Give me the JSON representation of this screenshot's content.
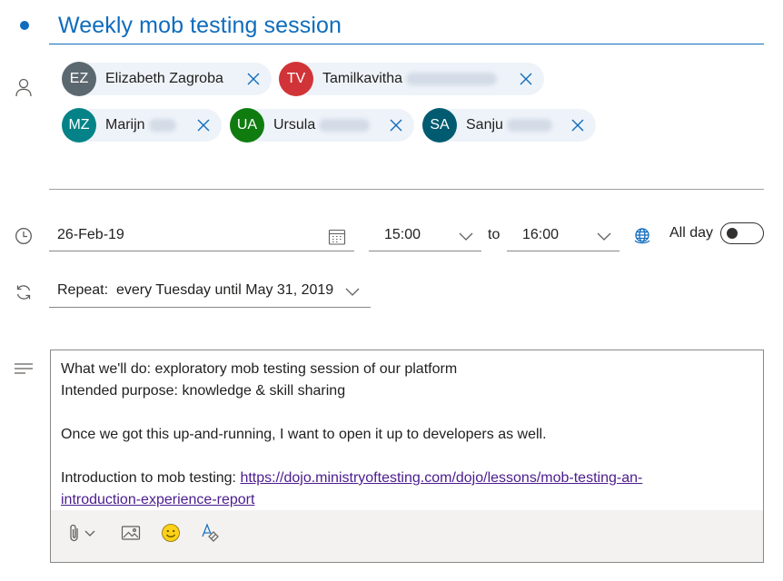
{
  "title": {
    "text": "Weekly mob testing session"
  },
  "attendees": [
    {
      "initials": "EZ",
      "name": "Elizabeth Zagroba",
      "color": "#5c6870"
    },
    {
      "initials": "TV",
      "name": "Tamilkavitha",
      "color": "#d13438"
    },
    {
      "initials": "MZ",
      "name": "Marijn",
      "color": "#038387"
    },
    {
      "initials": "UA",
      "name": "Ursula",
      "color": "#107c10"
    },
    {
      "initials": "SA",
      "name": "Sanju",
      "color": "#005b70"
    }
  ],
  "schedule": {
    "date": "26-Feb-19",
    "start_time": "15:00",
    "to_label": "to",
    "end_time": "16:00",
    "all_day_label": "All day",
    "all_day_on": false
  },
  "repeat": {
    "label": "Repeat:",
    "value": "every Tuesday until May 31, 2019"
  },
  "body": {
    "line1": "What we'll do: exploratory mob testing session of our platform",
    "line2": "Intended purpose: knowledge & skill sharing",
    "line3": "Once we got this up-and-running, I want to open it up to developers as well.",
    "line4_prefix": "Introduction to mob testing: ",
    "link_part1": "https://dojo.ministryoftesting.com/dojo/lessons/mob-testing-an-",
    "link_part2": "introduction-experience-report"
  },
  "icons": {
    "attendees": "person-icon",
    "time": "clock-icon",
    "repeat": "sync-icon",
    "body": "text-lines-icon",
    "date_picker": "calendar-icon",
    "timezone": "globe-icon",
    "attach": "paperclip-icon",
    "image": "image-icon",
    "emoji": "emoji-icon",
    "format": "format-painter-icon"
  },
  "colors": {
    "accent": "#0f6cbd",
    "link": "#4b1c8e",
    "chip_bg": "#eef3f9",
    "toolbar_bg": "#f3f2f1"
  }
}
